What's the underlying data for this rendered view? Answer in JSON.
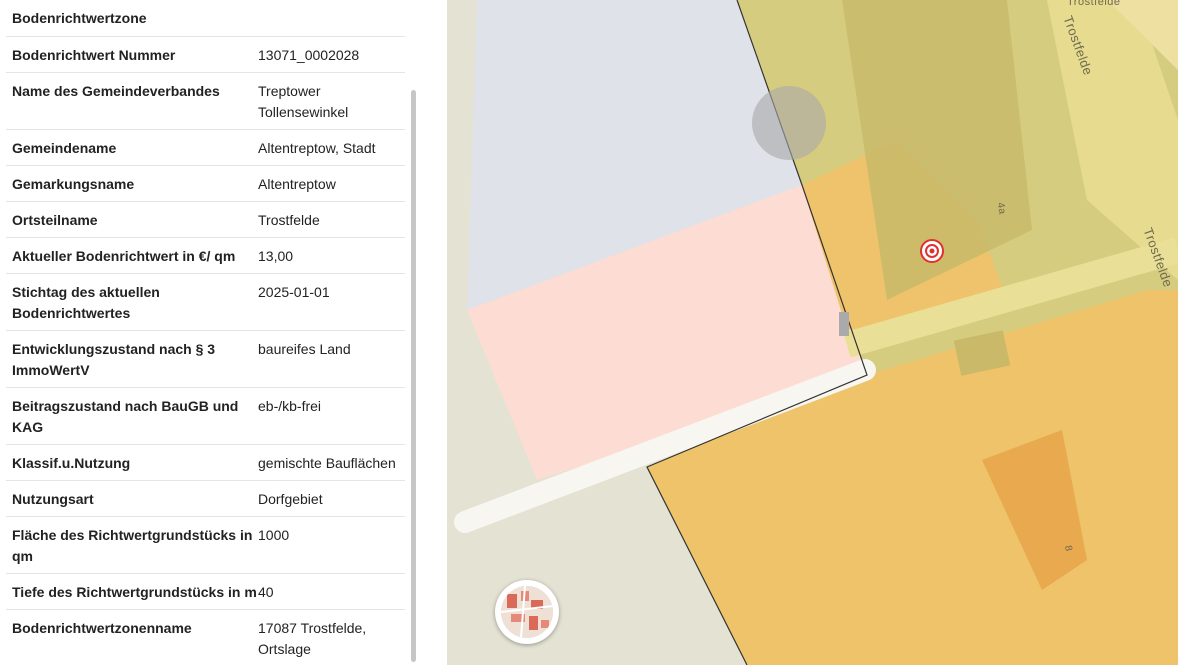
{
  "panel": {
    "section_title": "Bodenrichtwertzone",
    "rows": [
      {
        "label": "Bodenrichtwert Nummer",
        "value": "13071_0002028"
      },
      {
        "label": "Name des Gemeindeverbandes",
        "value": "Treptower Tollensewinkel"
      },
      {
        "label": "Gemeindename",
        "value": "Altentreptow, Stadt"
      },
      {
        "label": "Gemarkungsname",
        "value": "Altentreptow"
      },
      {
        "label": "Ortsteilname",
        "value": "Trostfelde"
      },
      {
        "label": "Aktueller Bodenrichtwert in €/ qm",
        "value": "13,00"
      },
      {
        "label": "Stichtag des aktuellen Bodenrichtwertes",
        "value": "2025-01-01"
      },
      {
        "label": "Entwicklungszustand nach § 3 ImmoWertV",
        "value": "baureifes Land"
      },
      {
        "label": "Beitragszustand nach BauGB und KAG",
        "value": "eb-/kb-frei"
      },
      {
        "label": "Klassif.u.Nutzung",
        "value": "gemischte Bauflächen"
      },
      {
        "label": "Nutzungsart",
        "value": "Dorfgebiet"
      },
      {
        "label": "Fläche des Richtwertgrundstücks in qm",
        "value": "1000"
      },
      {
        "label": "Tiefe des Richtwertgrundstücks in m",
        "value": "40"
      },
      {
        "label": "Bodenrichtwertzonenname",
        "value": "17087 Trostfelde, Ortslage"
      }
    ]
  },
  "map": {
    "street_labels": [
      "Trostfelde",
      "Trostfelde",
      "Trostfelde"
    ],
    "house_numbers": [
      "4a",
      "8"
    ],
    "icons": {
      "location_marker": "target-marker-icon",
      "minimap": "minimap-toggle-icon",
      "splitter": "vertical-dots-icon"
    },
    "colors": {
      "zone_blue": "#dfe2e8",
      "zone_pink": "#fdddd4",
      "zone_orange": "#f0c467",
      "zone_olive": "#d2c77a",
      "marker": "#e03030"
    }
  }
}
